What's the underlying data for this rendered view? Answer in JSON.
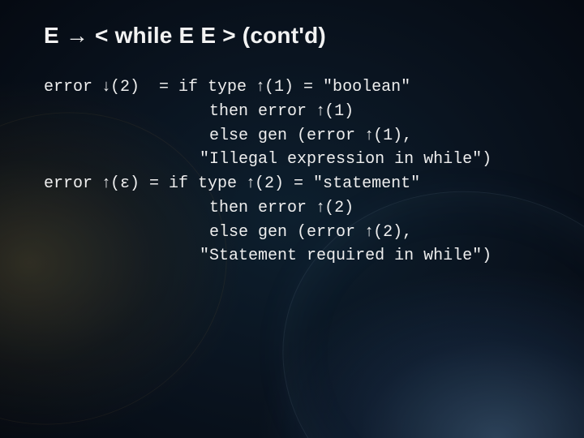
{
  "title": "E → < while E E > (cont'd)",
  "code": {
    "l1a": "error ",
    "l1arrow": "↓",
    "l1b": "(2)  = if type ",
    "l1arrow2": "↑",
    "l1c": "(1) = \"boolean\"",
    "l2a": "                 then error ",
    "l2arrow": "↑",
    "l2b": "(1)",
    "l3a": "                 else gen (error ",
    "l3arrow": "↑",
    "l3b": "(1),",
    "l4": "                \"Illegal expression in while\")",
    "l5a": "error ",
    "l5arrow": "↑",
    "l5b": "(ε) = if type ",
    "l5arrow2": "↑",
    "l5c": "(2) = \"statement\"",
    "l6a": "                 then error ",
    "l6arrow": "↑",
    "l6b": "(2)",
    "l7a": "                 else gen (error ",
    "l7arrow": "↑",
    "l7b": "(2),",
    "l8": "                \"Statement required in while\")"
  }
}
